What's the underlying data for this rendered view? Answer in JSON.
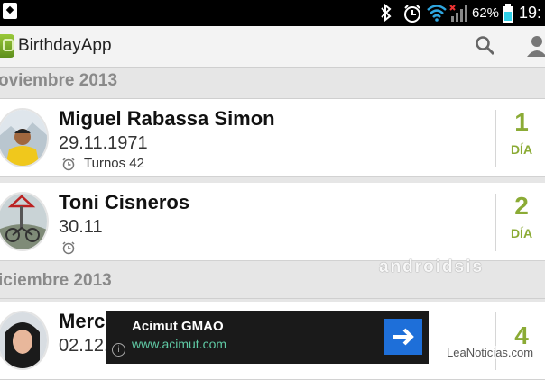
{
  "status_bar": {
    "battery": "62%",
    "time": "19:"
  },
  "app_bar": {
    "title": "BirthdayApp"
  },
  "sections": [
    {
      "header": "oviembre 2013"
    },
    {
      "header": "iciembre 2013"
    }
  ],
  "contacts": [
    {
      "name": "Miguel Rabassa Simon",
      "date": "29.11.1971",
      "reminder": "Turnos 42",
      "days": "1",
      "days_label": "DÍA"
    },
    {
      "name": "Toni Cisneros",
      "date": "30.11",
      "reminder": "",
      "days": "2",
      "days_label": "DÍA"
    },
    {
      "name": "Merch",
      "date": "02.12.",
      "reminder": "",
      "days": "4",
      "days_label": ""
    }
  ],
  "ad": {
    "title": "Acimut GMAO",
    "url": "www.acimut.com",
    "info": "i"
  },
  "watermarks": {
    "androidsis": "androidsis",
    "site": "LeaNoticias.com"
  },
  "colors": {
    "accent": "#8bab35",
    "ad_button": "#1e6fd9",
    "ad_url": "#5fc9a4"
  }
}
